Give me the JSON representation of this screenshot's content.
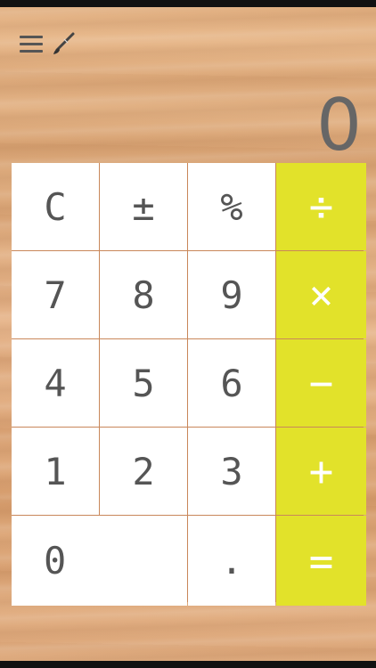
{
  "display": {
    "value": "0"
  },
  "icons": {
    "menu": "hamburger-menu-icon",
    "theme": "paintbrush-icon"
  },
  "colors": {
    "operator": "#e2e22a",
    "key": "#ffffff",
    "key_text": "#555555",
    "display_text": "#666666"
  },
  "keys": {
    "clear": "C",
    "sign": "±",
    "percent": "%",
    "divide": "÷",
    "seven": "7",
    "eight": "8",
    "nine": "9",
    "multiply": "×",
    "four": "4",
    "five": "5",
    "six": "6",
    "minus": "−",
    "one": "1",
    "two": "2",
    "three": "3",
    "plus": "+",
    "zero": "0",
    "decimal": ".",
    "equals": "="
  }
}
